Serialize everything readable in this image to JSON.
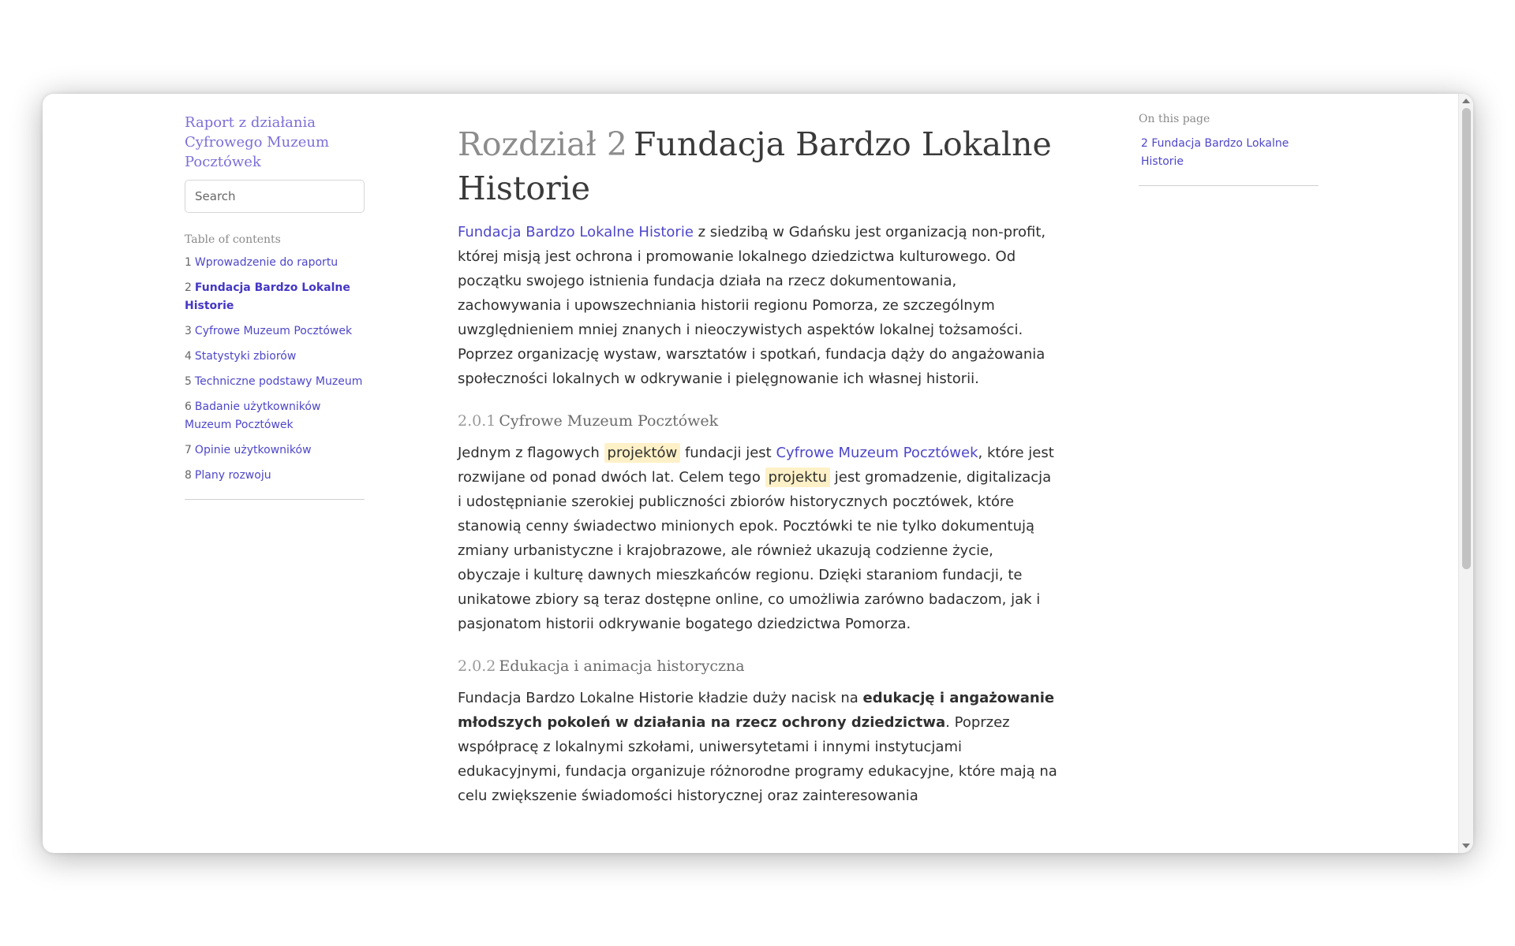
{
  "sidebar": {
    "site_title": "Raport z działania Cyfrowego Muzeum Pocztówek",
    "search_placeholder": "Search",
    "toc_heading": "Table of contents",
    "toc": [
      {
        "num": "1",
        "label": "Wprowadzenie do raportu"
      },
      {
        "num": "2",
        "label": "Fundacja Bardzo Lokalne Historie",
        "active": true
      },
      {
        "num": "3",
        "label": "Cyfrowe Muzeum Pocztówek"
      },
      {
        "num": "4",
        "label": "Statystyki zbiorów"
      },
      {
        "num": "5",
        "label": "Techniczne podstawy Muzeum"
      },
      {
        "num": "6",
        "label": "Badanie użytkowników Muzeum Pocztówek"
      },
      {
        "num": "7",
        "label": "Opinie użytkowników"
      },
      {
        "num": "8",
        "label": "Plany rozwoju"
      }
    ]
  },
  "main": {
    "chapter_num": "Rozdział 2",
    "chapter_title": "Fundacja Bardzo Lokalne Historie",
    "p1": {
      "link": "Fundacja Bardzo Lokalne Historie",
      "text": " z siedzibą w Gdańsku jest organizacją non-profit, której misją jest ochrona i promowanie lokalnego dziedzictwa kulturowego. Od początku swojego istnienia fundacja działa na rzecz dokumentowania, zachowywania i upowszechniania historii regionu Pomorza, ze szczególnym uwzględnieniem mniej znanych i nieoczywistych aspektów lokalnej tożsamości. Poprzez organizację wystaw, warsztatów i spotkań, fundacja dąży do angażowania społeczności lokalnych w odkrywanie i pielęgnowanie ich własnej historii."
    },
    "s1": {
      "num": "2.0.1",
      "title": "Cyfrowe Muzeum Pocztówek"
    },
    "p2": {
      "t1": "Jednym z flagowych ",
      "hl1": "projektów",
      "t2": " fundacji jest ",
      "link": "Cyfrowe Muzeum Pocztówek",
      "t3": ", które jest rozwijane od ponad dwóch lat. Celem tego ",
      "hl2": "projektu",
      "t4": " jest gromadzenie, digitalizacja i udostępnianie szerokiej publiczności zbiorów historycznych pocztówek, które stanowią cenny świadectwo minionych epok. Pocztówki te nie tylko dokumentują zmiany urbanistyczne i krajobrazowe, ale również ukazują codzienne życie, obyczaje i kulturę dawnych mieszkańców regionu. Dzięki staraniom fundacji, te unikatowe zbiory są teraz dostępne online, co umożliwia zarówno badaczom, jak i pasjonatom historii odkrywanie bogatego dziedzictwa Pomorza."
    },
    "s2": {
      "num": "2.0.2",
      "title": "Edukacja i animacja historyczna"
    },
    "p3": {
      "t1": "Fundacja Bardzo Lokalne Historie kładzie duży nacisk na ",
      "bold": "edukację i angażowanie młodszych pokoleń w działania na rzecz ochrony dziedzictwa",
      "t2": ". Poprzez współpracę z lokalnymi szkołami, uniwersytetami i innymi instytucjami edukacyjnymi, fundacja organizuje różnorodne programy edukacyjne, które mają na celu zwiększenie świadomości historycznej oraz zainteresowania"
    }
  },
  "onpage": {
    "heading": "On this page",
    "link": "2 Fundacja Bardzo Lokalne Historie"
  }
}
